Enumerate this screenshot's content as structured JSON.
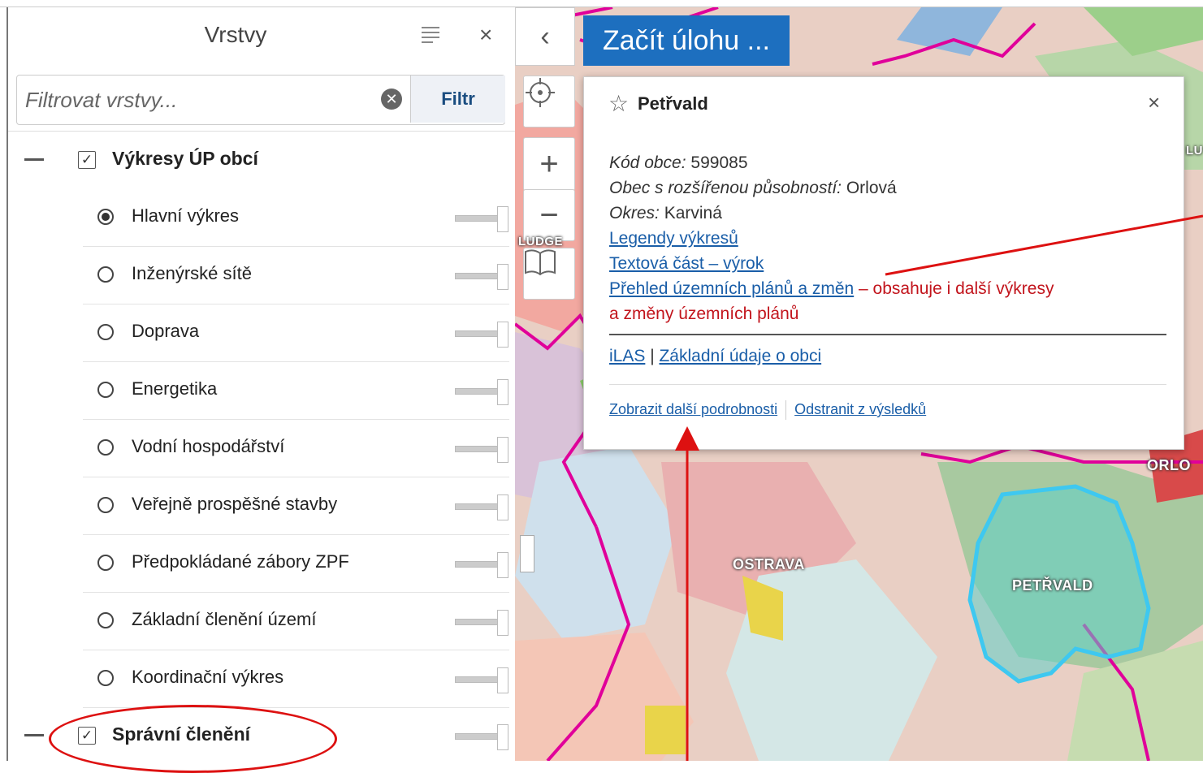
{
  "panel": {
    "title": "Vrstvy",
    "menu_icon": "menu-icon",
    "close_icon": "close-icon",
    "close_glyph": "×",
    "filter_placeholder": "Filtrovat vrstvy...",
    "filter_button": "Filtr",
    "clear_glyph": "✕"
  },
  "groups": [
    {
      "label": "Výkresy ÚP obcí",
      "checked": true
    },
    {
      "label": "Správní členění",
      "checked": true
    }
  ],
  "layers": [
    {
      "label": "Hlavní výkres",
      "selected": true
    },
    {
      "label": "Inženýrské sítě",
      "selected": false
    },
    {
      "label": "Doprava",
      "selected": false
    },
    {
      "label": "Energetika",
      "selected": false
    },
    {
      "label": "Vodní hospodářství",
      "selected": false
    },
    {
      "label": "Veřejně prospěšné stavby",
      "selected": false
    },
    {
      "label": "Předpokládané zábory ZPF",
      "selected": false
    },
    {
      "label": "Základní členění území",
      "selected": false
    },
    {
      "label": "Koordinační výkres",
      "selected": false
    }
  ],
  "map": {
    "start_task": "Začít úlohu ...",
    "labels": {
      "ostrava": "OSTRAVA",
      "petrvald": "PETŘVALD",
      "orlova": "ORLO",
      "ludgerovice": "LUDGE",
      "lu": "LU"
    },
    "colors": {
      "popup_link": "#1a5ea8",
      "note_red": "#c2141c",
      "task_button": "#1d6fbf",
      "border": "#e0009a",
      "highlight": "#3ec8f0"
    }
  },
  "popup": {
    "title": "Petřvald",
    "close_glyph": "×",
    "star_glyph": "☆",
    "kod_label": "Kód obce:",
    "kod_value": "599085",
    "orp_label": "Obec s rozšířenou působností:",
    "orp_value": "Orlová",
    "okres_label": "Okres:",
    "okres_value": "Karviná",
    "link_legendy": "Legendy výkresů",
    "link_textova": "Textová část – výrok",
    "link_prehled": "Přehled územních plánů a změn",
    "note_1": " – obsahuje i další výkresy",
    "note_2": "a změny územních plánů",
    "link_ilas": "iLAS",
    "separator": " | ",
    "link_zakladni": "Základní údaje o obci",
    "footer_more": "Zobrazit další podrobnosti",
    "footer_remove": "Odstranit z výsledků"
  }
}
